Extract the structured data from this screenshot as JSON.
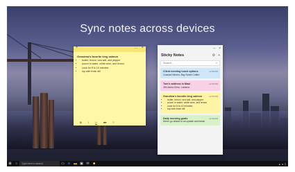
{
  "headline": "Sync notes across devices",
  "yellow_note": {
    "title": "Grandma's favorite king salmon",
    "items": [
      "butter, lemon, sea salt, and pepper",
      "pouch in water, white wine, and lemon",
      "cook for 8 to 10 minutes",
      "top with fresh dill"
    ],
    "toolbar": [
      "B",
      "I",
      "U",
      "ab",
      "≡"
    ],
    "add": "+",
    "more": "…",
    "close": "×"
  },
  "list": {
    "title": "Sticky Notes",
    "search_placeholder": "Search...",
    "cards": [
      {
        "title": "Client meeting lunch options",
        "subtitle": "Coastal Kitchen, Bay Street Coffee",
        "date": "12:30 PM",
        "color": "#cfe6f8"
      },
      {
        "title": "Tom's address in Maui",
        "subtitle": "354 Aloha Drive, Lahaina",
        "date": "12:30 PM",
        "color": "#f8d1e6"
      },
      {
        "title": "Grandma's favorite king salmon",
        "subtitle": "",
        "items": [
          "butter, lemon, sea salt, and pepper",
          "pouch in water, white wine, and lemon",
          "cook for 8 to 10 minutes",
          "top with fresh dill"
        ],
        "date": "12:30 PM",
        "color": "#fff4a3"
      },
      {
        "title": "Daily morning goals",
        "subtitle": "Never go ahead to an update and break",
        "date": "12:30 PM",
        "color": "#d8f1c9"
      }
    ]
  },
  "taskbar": {
    "search_text": "Type here to search"
  }
}
